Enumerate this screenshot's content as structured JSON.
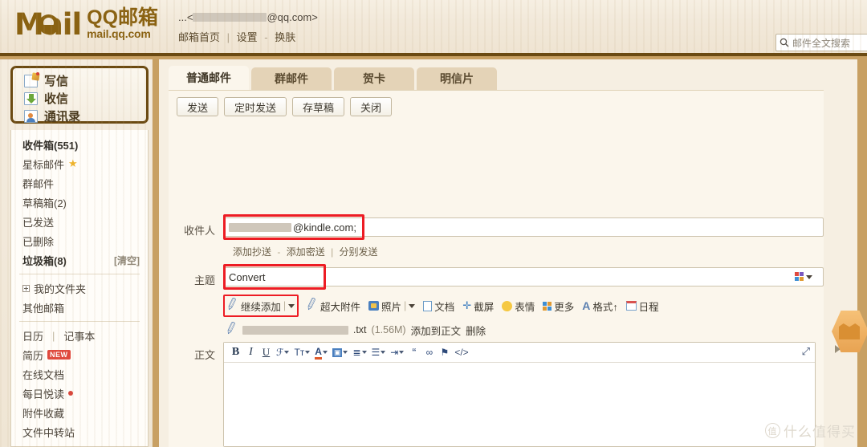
{
  "header": {
    "logo_mail": "Mail",
    "logo_cn": "QQ邮箱",
    "logo_url": "mail.qq.com",
    "account_prefix": "...<",
    "account_suffix": "@qq.com>",
    "links": [
      {
        "label": "邮箱首页"
      },
      {
        "label": "设置"
      },
      {
        "label": "换肤"
      }
    ],
    "search": {
      "placeholder": "邮件全文搜索",
      "icon": "search-icon"
    }
  },
  "sidebar": {
    "compose": [
      {
        "label": "写信",
        "icon": "write-icon"
      },
      {
        "label": "收信",
        "icon": "receive-icon"
      },
      {
        "label": "通讯录",
        "icon": "contacts-icon"
      }
    ],
    "folders": [
      {
        "label": "收件箱(551)",
        "bold": true
      },
      {
        "label": "星标邮件",
        "star": true
      },
      {
        "label": "群邮件"
      },
      {
        "label": "草稿箱(2)"
      },
      {
        "label": "已发送"
      },
      {
        "label": "已删除"
      },
      {
        "label": "垃圾箱(8)",
        "bold": true,
        "action": "[清空]"
      }
    ],
    "myfolders": {
      "label": "我的文件夹",
      "icon": "plus-box-icon"
    },
    "other_mailbox": {
      "label": "其他邮箱"
    },
    "tools": [
      {
        "label": "日历",
        "pipe": "|",
        "label2": "记事本"
      },
      {
        "label": "简历",
        "badge": "NEW"
      },
      {
        "label": "在线文档"
      },
      {
        "label": "每日悦读",
        "dot": true
      },
      {
        "label": "附件收藏"
      },
      {
        "label": "文件中转站"
      }
    ]
  },
  "main": {
    "tabs": [
      {
        "label": "普通邮件",
        "active": true
      },
      {
        "label": "群邮件",
        "active": false
      },
      {
        "label": "贺卡",
        "active": false
      },
      {
        "label": "明信片",
        "active": false
      }
    ],
    "buttons": [
      {
        "label": "发送"
      },
      {
        "label": "定时发送"
      },
      {
        "label": "存草稿"
      },
      {
        "label": "关闭"
      }
    ],
    "to_field": {
      "label": "收件人",
      "value_suffix": "@kindle.com;",
      "highlighted": true
    },
    "cc_links": [
      {
        "label": "添加抄送"
      },
      {
        "label": "添加密送"
      },
      {
        "label": "分别发送"
      }
    ],
    "subject_field": {
      "label": "主题",
      "value": "Convert",
      "highlighted": true
    },
    "template_button": {
      "icon": "template-grid-icon"
    },
    "attach_bar": [
      {
        "label": "继续添加",
        "icon": "paperclip-icon",
        "caret": true,
        "highlighted": true
      },
      {
        "label": "超大附件",
        "icon": "paperclip-icon"
      },
      {
        "label": "照片",
        "icon": "photo-icon",
        "caret": true
      },
      {
        "label": "文档",
        "icon": "document-icon"
      },
      {
        "label": "截屏",
        "icon": "screenshot-icon"
      },
      {
        "label": "表情",
        "icon": "emoji-icon"
      },
      {
        "label": "更多",
        "icon": "more-grid-icon"
      },
      {
        "label": "格式↑",
        "icon": "format-A-icon"
      },
      {
        "label": "日程",
        "icon": "calendar-icon"
      }
    ],
    "attached_file": {
      "icon": "paperclip-icon",
      "name_suffix": ".txt",
      "size": "(1.56M)",
      "add_to_body": "添加到正文",
      "delete": "删除"
    },
    "body_label": "正文",
    "editor_tools": [
      {
        "name": "bold-icon",
        "glyph": "B",
        "style": "bold-i"
      },
      {
        "name": "italic-icon",
        "glyph": "I",
        "style": "ital-i"
      },
      {
        "name": "underline-icon",
        "glyph": "U",
        "style": "und-i"
      },
      {
        "name": "font-family-icon",
        "glyph": "ℱ",
        "caret": true
      },
      {
        "name": "font-size-icon",
        "glyph": "Tт",
        "caret": true
      },
      {
        "name": "font-color-icon",
        "glyph": "A",
        "caret": true,
        "underline_color": "#e05a2b"
      },
      {
        "name": "highlight-color-icon",
        "glyph": "▣",
        "caret": true
      },
      {
        "name": "align-icon",
        "glyph": "≣",
        "caret": true
      },
      {
        "name": "bullet-list-icon",
        "glyph": "☰",
        "caret": true
      },
      {
        "name": "indent-icon",
        "glyph": "⇥",
        "caret": true
      },
      {
        "name": "quote-icon",
        "glyph": "“"
      },
      {
        "name": "link-icon",
        "glyph": "∞"
      },
      {
        "name": "clear-format-icon",
        "glyph": "⚑"
      },
      {
        "name": "source-code-icon",
        "glyph": "</>"
      }
    ],
    "expand_icon": "expand-icon",
    "body_value": ""
  },
  "watermark": {
    "mark": "值",
    "text": "什么值得买"
  },
  "colors": {
    "accent_red": "#ed1c24",
    "brand_brown": "#8a6212",
    "border_dark": "#6b4a12",
    "tab_inactive": "#e4d3b7",
    "panel_bg": "#fbf6ec"
  }
}
